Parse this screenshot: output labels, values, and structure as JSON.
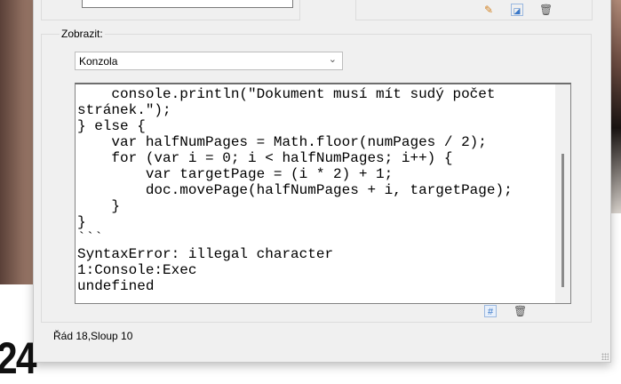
{
  "dialog": {
    "group_label": "Zobrazit:",
    "view_select": {
      "selected": "Konzola"
    },
    "console_lines": [
      "    console.println(\"Dokument musí mít sudý počet",
      "stránek.\");",
      "} else {",
      "    var halfNumPages = Math.floor(numPages / 2);",
      "    for (var i = 0; i < halfNumPages; i++) {",
      "        var targetPage = (i * 2) + 1;",
      "        doc.movePage(halfNumPages + i, targetPage);",
      "    }",
      "}",
      "```",
      "SyntaxError: illegal character",
      "1:Console:Exec",
      "undefined"
    ],
    "status": "Řád 18,Sloup 10"
  },
  "background": {
    "number": "24"
  }
}
